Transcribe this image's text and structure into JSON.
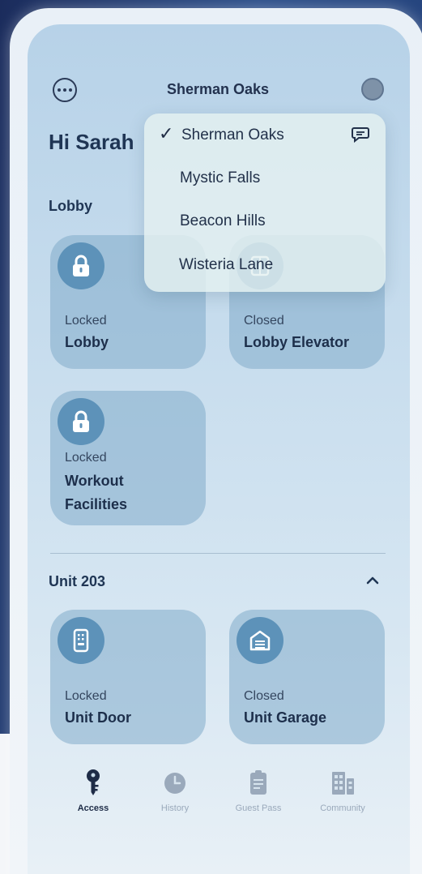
{
  "header": {
    "location": "Sherman Oaks"
  },
  "greeting": "Hi Sarah",
  "lobby": {
    "title": "Lobby",
    "cards": [
      {
        "status": "Locked",
        "name": "Lobby"
      },
      {
        "status": "Closed",
        "name": "Lobby Elevator"
      },
      {
        "status": "Locked",
        "name_line1": "Workout",
        "name_line2": "Facilities"
      }
    ]
  },
  "unit": {
    "title": "Unit 203",
    "cards": [
      {
        "status": "Locked",
        "name": "Unit Door"
      },
      {
        "status": "Closed",
        "name": "Unit Garage"
      }
    ]
  },
  "dropdown": {
    "selected": "Sherman Oaks",
    "options": [
      "Sherman Oaks",
      "Mystic Falls",
      "Beacon Hills",
      "Wisteria Lane"
    ]
  },
  "tabs": [
    {
      "label": "Access",
      "icon": "key-icon",
      "active": true
    },
    {
      "label": "History",
      "icon": "clock-icon",
      "active": false
    },
    {
      "label": "Guest Pass",
      "icon": "guest-pass-icon",
      "active": false
    },
    {
      "label": "Community",
      "icon": "building-icon",
      "active": false
    }
  ],
  "colors": {
    "accent": "#5d92b9",
    "card": "#a3c2d8",
    "text_dark": "#1d2f4b"
  }
}
